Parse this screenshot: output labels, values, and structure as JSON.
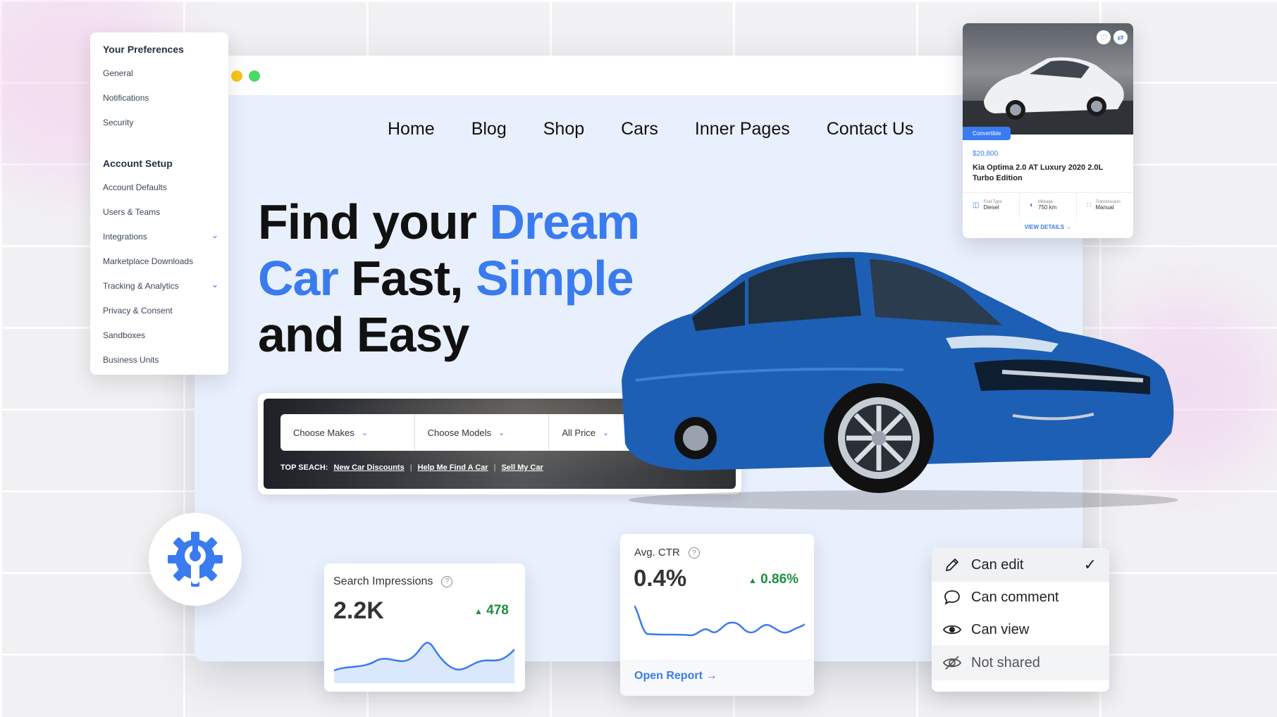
{
  "nav": {
    "items": [
      "Home",
      "Blog",
      "Shop",
      "Cars",
      "Inner Pages",
      "Contact Us"
    ]
  },
  "hero": {
    "line1_a": "Find your ",
    "line1_b": "Dream",
    "line2_a": "Car",
    "line2_b": " Fast, ",
    "line2_c": "Simple",
    "line3": "and Easy"
  },
  "search": {
    "makes": "Choose Makes",
    "models": "Choose Models",
    "price": "All Price",
    "top_label": "TOP SEACH:",
    "links": [
      "New Car Discounts",
      "Help Me Find A Car",
      "Sell My Car"
    ]
  },
  "sidebar": {
    "sections": [
      {
        "heading": "Your Preferences",
        "items": [
          "General",
          "Notifications",
          "Security"
        ]
      },
      {
        "heading": "Account Setup",
        "items": [
          "Account Defaults",
          "Users & Teams",
          "Integrations",
          "Marketplace Downloads",
          "Tracking & Analytics",
          "Privacy & Consent",
          "Sandboxes",
          "Business Units"
        ]
      }
    ]
  },
  "car_card": {
    "badge": "Convertible",
    "price": "$20,800",
    "title": "Kia Optima 2.0 AT Luxury 2020 2.0L Turbo Edition",
    "specs": [
      {
        "label": "Fuel Type",
        "value": "Diesel"
      },
      {
        "label": "Mileage",
        "value": "750 km"
      },
      {
        "label": "Transmission",
        "value": "Manual"
      }
    ],
    "link": "VIEW DETAILS"
  },
  "impressions": {
    "label": "Search Impressions",
    "value": "2.2K",
    "delta": "478"
  },
  "ctr": {
    "label": "Avg. CTR",
    "value": "0.4%",
    "delta": "0.86%",
    "link": "Open Report"
  },
  "share": {
    "options": [
      "Can edit",
      "Can comment",
      "Can view",
      "Not shared"
    ]
  },
  "colors": {
    "accent": "#3a7bf0",
    "positive": "#1e8e3e",
    "car_body": "#1d5fb5"
  }
}
